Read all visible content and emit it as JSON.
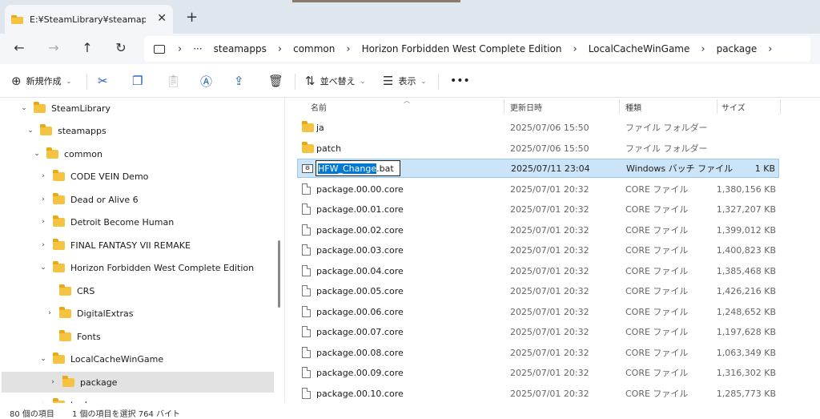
{
  "window": {
    "tab_title": "E:¥SteamLibrary¥steamapps¥c",
    "new_tab": "+",
    "close": "✕"
  },
  "address": {
    "more": "···",
    "crumbs": [
      "steamapps",
      "common",
      "Horizon Forbidden West Complete Edition",
      "LocalCacheWinGame",
      "package"
    ]
  },
  "commands": {
    "new_label": "新規作成",
    "sort_label": "並べ替え",
    "view_label": "表示",
    "more": "•••"
  },
  "nav": {
    "items": [
      {
        "label": "SteamLibrary",
        "chev": "⌄"
      },
      {
        "label": "steamapps",
        "chev": "⌄"
      },
      {
        "label": "common",
        "chev": "⌄"
      },
      {
        "label": "CODE VEIN Demo",
        "chev": "›"
      },
      {
        "label": "Dead or Alive 6",
        "chev": "›"
      },
      {
        "label": "Detroit Become Human",
        "chev": "›"
      },
      {
        "label": "FINAL FANTASY VII REMAKE",
        "chev": "›"
      },
      {
        "label": "Horizon Forbidden West Complete Edition",
        "chev": "⌄"
      },
      {
        "label": "CRS",
        "chev": ""
      },
      {
        "label": "DigitalExtras",
        "chev": "›"
      },
      {
        "label": "Fonts",
        "chev": ""
      },
      {
        "label": "LocalCacheWinGame",
        "chev": "⌄"
      },
      {
        "label": "package",
        "chev": "›"
      },
      {
        "label": "tools",
        "chev": "›"
      }
    ]
  },
  "list": {
    "headers": {
      "name": "名前",
      "date": "更新日時",
      "type": "種類",
      "size": "サイズ"
    },
    "rename_selected": "HFW_Change",
    "rename_rest": ".bat",
    "rows": [
      {
        "name": "ja",
        "date": "2025/07/06 15:50",
        "type": "ファイル フォルダー",
        "size": "",
        "kind": "folder"
      },
      {
        "name": "patch",
        "date": "2025/07/06 15:50",
        "type": "ファイル フォルダー",
        "size": "",
        "kind": "folder"
      },
      {
        "name": "HFW_Change.bat",
        "date": "2025/07/11 23:04",
        "type": "Windows バッチ ファイル",
        "size": "1 KB",
        "kind": "bat"
      },
      {
        "name": "package.00.00.core",
        "date": "2025/07/01 20:32",
        "type": "CORE ファイル",
        "size": "1,380,156 KB",
        "kind": "file"
      },
      {
        "name": "package.00.01.core",
        "date": "2025/07/01 20:32",
        "type": "CORE ファイル",
        "size": "1,327,207 KB",
        "kind": "file"
      },
      {
        "name": "package.00.02.core",
        "date": "2025/07/01 20:32",
        "type": "CORE ファイル",
        "size": "1,399,012 KB",
        "kind": "file"
      },
      {
        "name": "package.00.03.core",
        "date": "2025/07/01 20:32",
        "type": "CORE ファイル",
        "size": "1,400,823 KB",
        "kind": "file"
      },
      {
        "name": "package.00.04.core",
        "date": "2025/07/01 20:32",
        "type": "CORE ファイル",
        "size": "1,385,468 KB",
        "kind": "file"
      },
      {
        "name": "package.00.05.core",
        "date": "2025/07/01 20:32",
        "type": "CORE ファイル",
        "size": "1,426,216 KB",
        "kind": "file"
      },
      {
        "name": "package.00.06.core",
        "date": "2025/07/01 20:32",
        "type": "CORE ファイル",
        "size": "1,248,652 KB",
        "kind": "file"
      },
      {
        "name": "package.00.07.core",
        "date": "2025/07/01 20:32",
        "type": "CORE ファイル",
        "size": "1,197,628 KB",
        "kind": "file"
      },
      {
        "name": "package.00.08.core",
        "date": "2025/07/01 20:32",
        "type": "CORE ファイル",
        "size": "1,063,349 KB",
        "kind": "file"
      },
      {
        "name": "package.00.09.core",
        "date": "2025/07/01 20:32",
        "type": "CORE ファイル",
        "size": "1,316,302 KB",
        "kind": "file"
      },
      {
        "name": "package.00.10.core",
        "date": "2025/07/01 20:32",
        "type": "CORE ファイル",
        "size": "1,285,773 KB",
        "kind": "file"
      }
    ]
  },
  "status": {
    "count": "80 個の項目",
    "selection": "1 個の項目を選択  764 バイト"
  },
  "colors": {
    "accent": "#0078d4",
    "selection_bg": "#cce4f7",
    "folder": "#f5c342"
  }
}
